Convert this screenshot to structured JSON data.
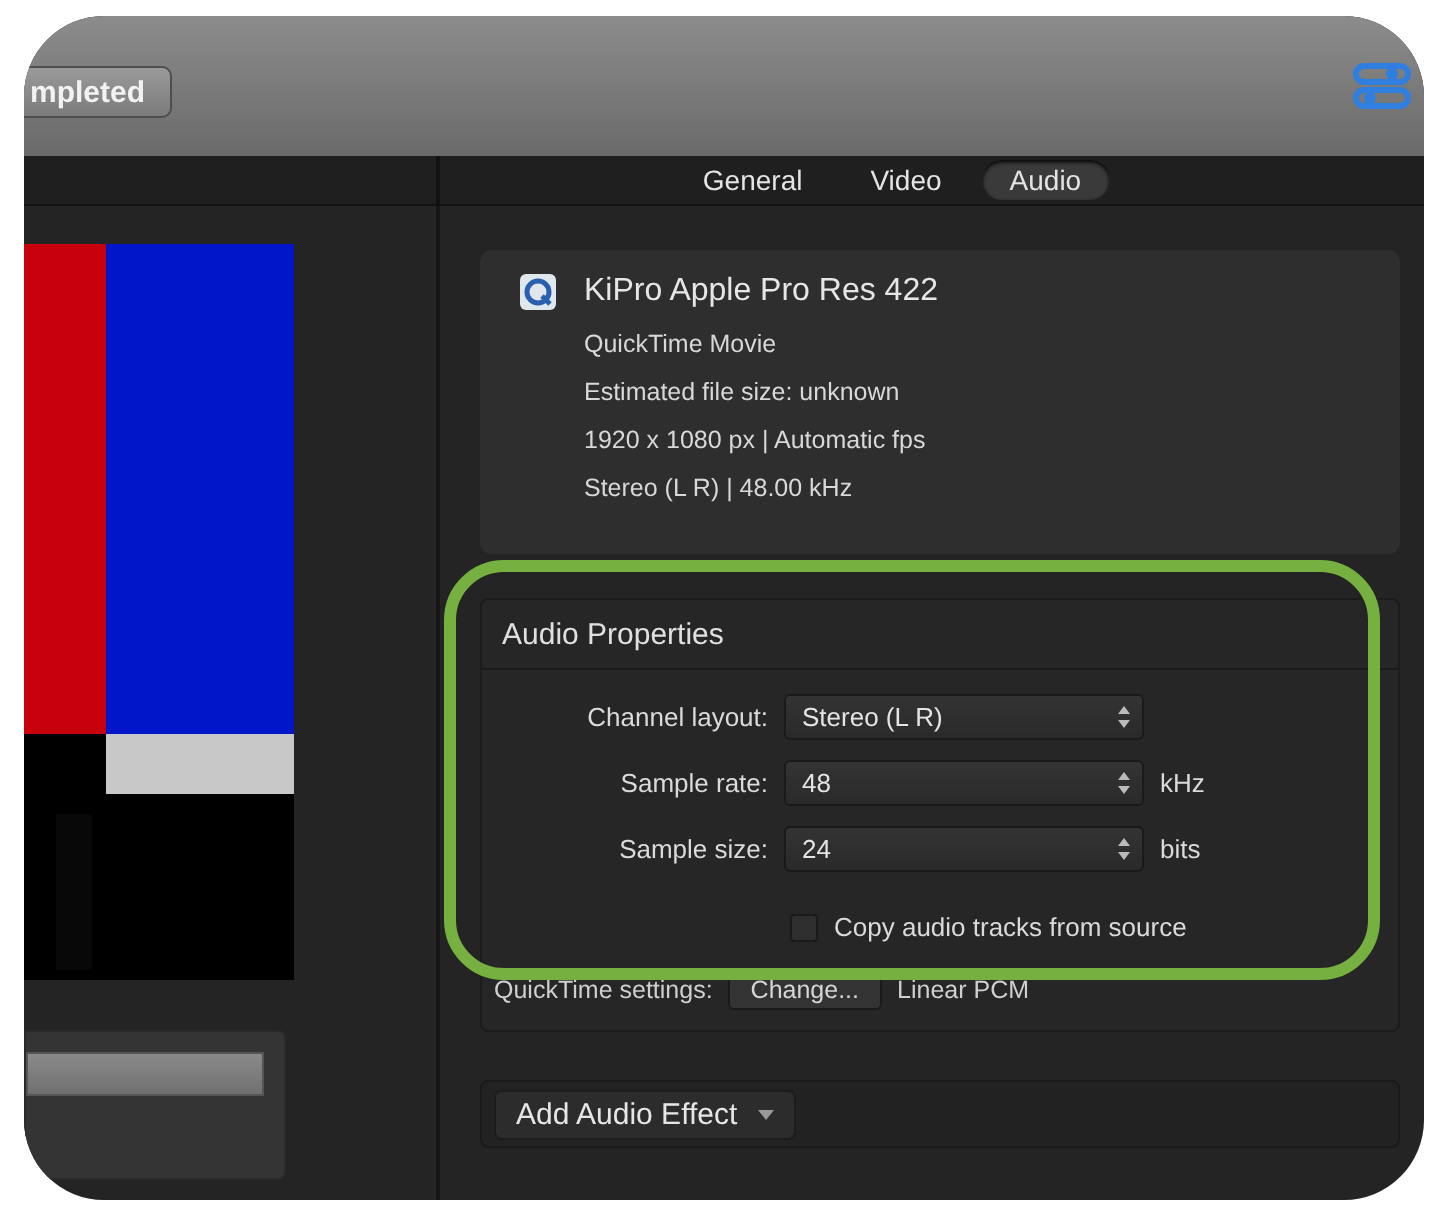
{
  "toolbar": {
    "status_button": "mpleted"
  },
  "tabs": [
    {
      "label": "General",
      "selected": false
    },
    {
      "label": "Video",
      "selected": false
    },
    {
      "label": "Audio",
      "selected": true
    }
  ],
  "info": {
    "title": "KiPro Apple Pro Res 422",
    "lines": [
      "QuickTime Movie",
      "Estimated file size: unknown",
      "1920 x 1080 px | Automatic fps",
      "Stereo (L R) | 48.00 kHz"
    ]
  },
  "audio_properties": {
    "title": "Audio Properties",
    "rows": [
      {
        "label": "Channel layout:",
        "value": "Stereo (L R)"
      },
      {
        "label": "Sample rate:",
        "value": "48",
        "unit": "kHz"
      },
      {
        "label": "Sample size:",
        "value": "24",
        "unit": "bits"
      }
    ],
    "copy_tracks": {
      "label": "Copy audio tracks from source",
      "checked": false
    },
    "quicktime": {
      "label": "QuickTime settings:",
      "button": "Change...",
      "value": "Linear PCM"
    }
  },
  "effects": {
    "button": "Add Audio Effect"
  }
}
